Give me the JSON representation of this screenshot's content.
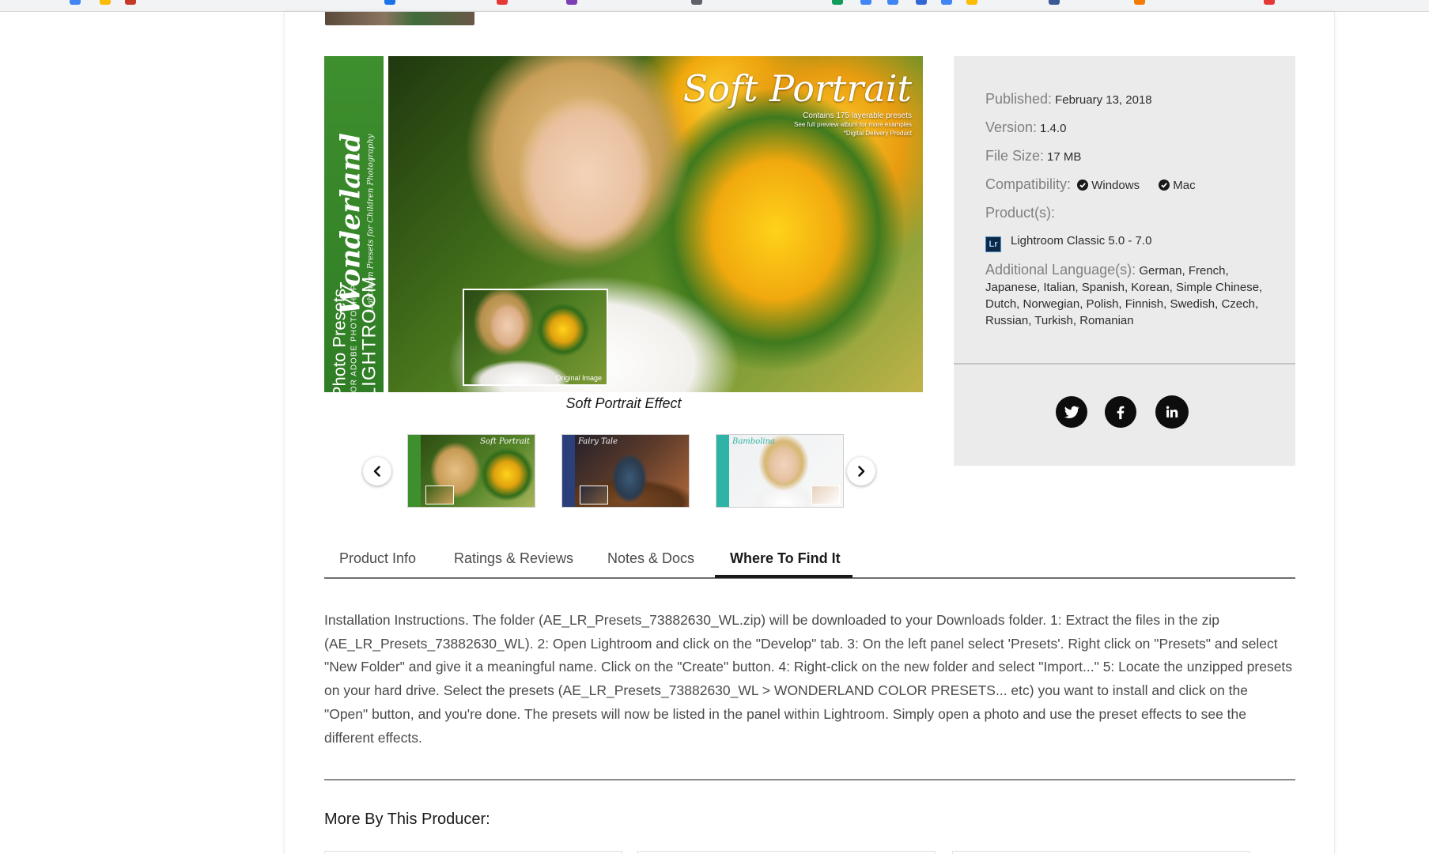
{
  "hero": {
    "title": "Soft Portrait",
    "desc_line1": "Contains 175 layerable presets",
    "desc_line2": "See full preview album for more examples",
    "desc_line3": "*Digital Delivery Product",
    "side_brand": "Wonderland",
    "side_sub": "Lightroom Presets for Children Photography",
    "side_photo_presets": "Photo Presets",
    "side_for_adobe": "FOR ADOBE PHOTOSHOP",
    "side_lightroom": "LIGHTROOM",
    "inset_label": "Original Image",
    "caption": "Soft Portrait Effect"
  },
  "thumbnails": [
    {
      "title": "Soft Portrait",
      "side_color": "#3e8f2e"
    },
    {
      "title": "Fairy Tale",
      "side_color": "#2b3f7a"
    },
    {
      "title": "Bambolina",
      "side_color": "#2fb3a6"
    }
  ],
  "info": {
    "published_label": "Published:",
    "published_value": "February 13, 2018",
    "version_label": "Version:",
    "version_value": "1.4.0",
    "filesize_label": "File Size:",
    "filesize_value": "17 MB",
    "compat_label": "Compatibility:",
    "compat_windows": "Windows",
    "compat_mac": "Mac",
    "products_label": "Product(s):",
    "product_name": "Lightroom Classic 5.0 - 7.0",
    "product_icon_text": "Lr",
    "languages_label": "Additional Language(s):",
    "languages_value": "German, French, Japanese, Italian, Spanish, Korean, Simple Chinese, Dutch, Norwegian, Polish, Finnish, Swedish, Czech, Russian, Turkish, Romanian"
  },
  "social": [
    "twitter-icon",
    "facebook-icon",
    "linkedin-icon"
  ],
  "tabs": [
    {
      "label": "Product Info"
    },
    {
      "label": "Ratings & Reviews"
    },
    {
      "label": "Notes & Docs"
    },
    {
      "label": "Where To Find It"
    }
  ],
  "instructions": "Installation Instructions. The folder (AE_LR_Presets_73882630_WL.zip) will be downloaded to your Downloads folder. 1: Extract the files in the zip (AE_LR_Presets_73882630_WL). 2: Open Lightroom and click on the \"Develop\" tab. 3: On the left panel select 'Presets'. Right click on \"Presets\" and select \"New Folder\" and give it a meaningful name. Click on the \"Create\" button. 4: Right-click on the new folder and select \"Import...\" 5: Locate the unzipped presets on your hard drive. Select the presets (AE_LR_Presets_73882630_WL > WONDERLAND COLOR PRESETS... etc) you want to install and click on the \"Open\" button, and you're done. The presets will now be listed in the panel within Lightroom. Simply open a photo and use the preset effects to see the different effects.",
  "more_title": "More By This Producer:",
  "colors": {
    "panel_bg": "#ebebeb",
    "brand_green": "#3e8f2e",
    "text_dark": "#1a1a1a"
  }
}
